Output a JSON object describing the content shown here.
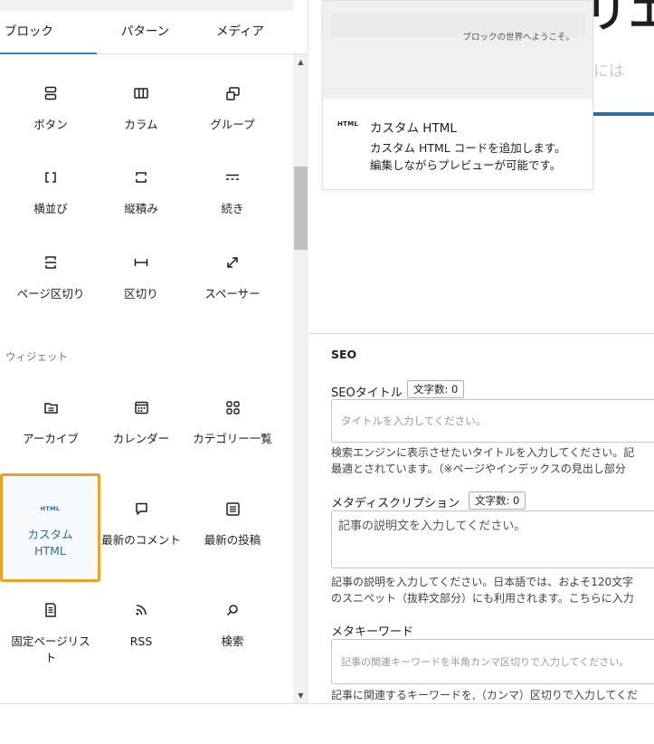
{
  "inserter": {
    "tabs": [
      {
        "label": "ブロック",
        "active": true
      },
      {
        "label": "パターン",
        "active": false
      },
      {
        "label": "メディア",
        "active": false
      }
    ],
    "blocks": [
      {
        "label": "ボタン",
        "icon": "buttons-icon"
      },
      {
        "label": "カラム",
        "icon": "columns-icon"
      },
      {
        "label": "グループ",
        "icon": "group-icon"
      },
      {
        "label": "横並び",
        "icon": "row-icon"
      },
      {
        "label": "縦積み",
        "icon": "stack-icon"
      },
      {
        "label": "続き",
        "icon": "more-icon"
      },
      {
        "label": "ページ区切り",
        "icon": "page-break-icon"
      },
      {
        "label": "区切り",
        "icon": "separator-icon"
      },
      {
        "label": "スペーサー",
        "icon": "spacer-icon"
      }
    ],
    "widgets_label": "ウィジェット",
    "widgets": [
      {
        "label": "アーカイブ",
        "icon": "archive-icon"
      },
      {
        "label": "カレンダー",
        "icon": "calendar-icon"
      },
      {
        "label": "カテゴリー一覧",
        "icon": "categories-icon"
      },
      {
        "label": "カスタム HTML",
        "icon": "html-icon",
        "icon_text": "HTML",
        "highlighted": true
      },
      {
        "label": "最新のコメント",
        "icon": "comment-icon"
      },
      {
        "label": "最新の投稿",
        "icon": "posts-list-icon"
      },
      {
        "label": "固定ページリスト",
        "icon": "page-list-icon"
      },
      {
        "label": "RSS",
        "icon": "rss-icon"
      },
      {
        "label": "検索",
        "icon": "search-icon"
      }
    ]
  },
  "preview": {
    "preview_text": "ブロックの世界へようこそ。",
    "icon_text": "HTML",
    "title": "カスタム HTML",
    "description_lines": [
      "カスタム HTML コードを追加します。",
      "編集しながらプレビューが可能です。"
    ]
  },
  "background": {
    "title_fragment": "リエ",
    "subtitle_fragment": "するには"
  },
  "seo": {
    "heading": "SEO",
    "title_label": "SEOタイトル",
    "title_count": "文字数: 0",
    "title_placeholder": "タイトルを入力してください。",
    "title_help_1": "検索エンジンに表示させたいタイトルを入力してください。記",
    "title_help_2": "最適とされています。（※ページやインデックスの見出し部分",
    "desc_label": "メタディスクリプション",
    "desc_count": "文字数: 0",
    "desc_placeholder": "記事の説明文を入力してください。",
    "desc_help_1": "記事の説明を入力してください。日本語では、およそ120文字",
    "desc_help_2": "のスニペット（抜粋文部分）にも利用されます。こちらに入力",
    "keywords_label": "メタキーワード",
    "keywords_placeholder": "記事の関連キーワードを半角カンマ区切りで入力してください。",
    "keywords_help": "記事に関連するキーワードを,（カンマ）区切りで入力してくだ"
  },
  "colors": {
    "accent": "#3582c4",
    "highlight_border": "#f0a01f",
    "link_blue": "#2a6ea3"
  }
}
